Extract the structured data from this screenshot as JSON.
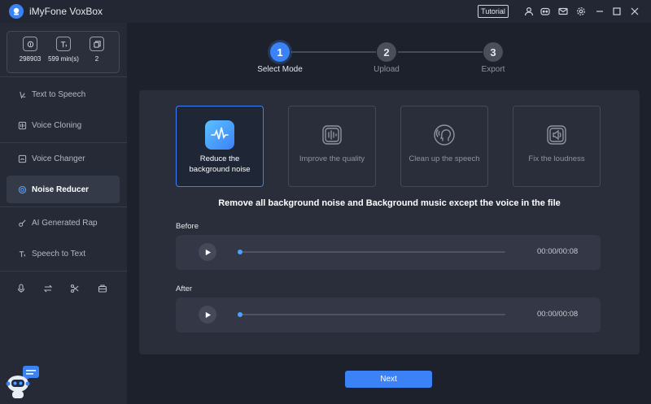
{
  "app": {
    "title": "iMyFone VoxBox",
    "tutorial_label": "Tutorial"
  },
  "stats": [
    {
      "icon": "voice-tag-icon",
      "value": "298903"
    },
    {
      "icon": "text-to-speech-icon",
      "value": "599 min(s)"
    },
    {
      "icon": "copy-icon",
      "value": "2"
    }
  ],
  "sidebar": {
    "items": [
      {
        "label": "Text to Speech",
        "icon": "text-to-speech-icon"
      },
      {
        "label": "Voice Cloning",
        "icon": "voice-cloning-icon"
      },
      {
        "label": "Voice Changer",
        "icon": "voice-changer-icon"
      },
      {
        "label": "Noise Reducer",
        "icon": "noise-reducer-icon",
        "active": true
      },
      {
        "label": "AI Generated Rap",
        "icon": "rap-icon"
      },
      {
        "label": "Speech to Text",
        "icon": "speech-to-text-icon"
      }
    ],
    "tools": [
      "microphone-icon",
      "convert-icon",
      "cut-icon",
      "toolbox-icon"
    ]
  },
  "steps": [
    {
      "number": "1",
      "label": "Select Mode",
      "state": "current"
    },
    {
      "number": "2",
      "label": "Upload",
      "state": "todo"
    },
    {
      "number": "3",
      "label": "Export",
      "state": "todo"
    }
  ],
  "modes": [
    {
      "label": "Reduce the background noise",
      "icon": "waveform-icon",
      "selected": true
    },
    {
      "label": "Improve the quality",
      "icon": "equalizer-icon",
      "selected": false
    },
    {
      "label": "Clean up the speech",
      "icon": "speaking-head-icon",
      "selected": false
    },
    {
      "label": "Fix the loudness",
      "icon": "speaker-icon",
      "selected": false
    }
  ],
  "description": "Remove all background noise and Background music except the voice in the file",
  "players": [
    {
      "title": "Before",
      "time": "00:00/00:08",
      "progress": 0
    },
    {
      "title": "After",
      "time": "00:00/00:08",
      "progress": 0
    }
  ],
  "next_label": "Next",
  "colors": {
    "accent": "#3b82f6",
    "background": "#1d212b",
    "sidebar": "#262a36",
    "panel": "#2a2e3a"
  }
}
